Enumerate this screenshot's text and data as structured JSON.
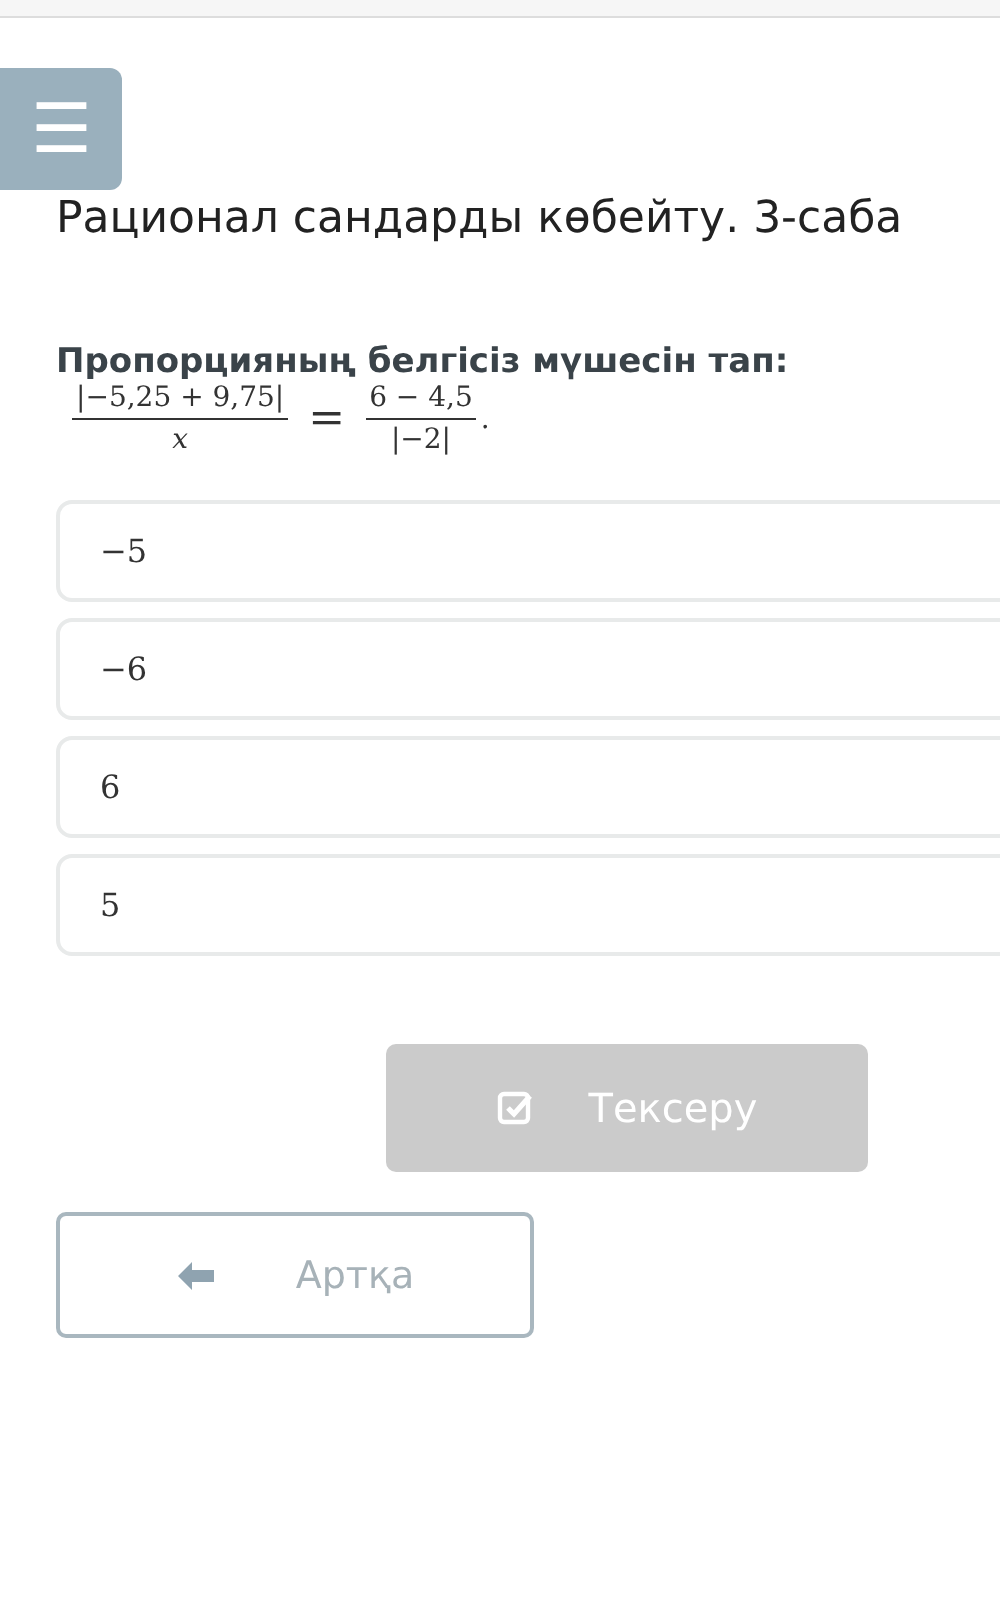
{
  "menu_button": {
    "label": "☰"
  },
  "title": "Рационал сандарды көбейту. 3-саба",
  "question": {
    "prompt": "Пропорцияның белгісіз мүшесін тап:",
    "equation": {
      "left_numerator": "|−5,25 + 9,75|",
      "left_denominator": "x",
      "equals": "=",
      "right_numerator": "6 − 4,5",
      "right_denominator": "|−2|",
      "end": "."
    }
  },
  "options": [
    {
      "label": "−5",
      "selected": false
    },
    {
      "label": "−6",
      "selected": false
    },
    {
      "label": "6",
      "selected": false
    },
    {
      "label": "5",
      "selected": false
    }
  ],
  "check_button": {
    "label": "Тексеру",
    "disabled": true
  },
  "back_button": {
    "label": "Артқа"
  }
}
